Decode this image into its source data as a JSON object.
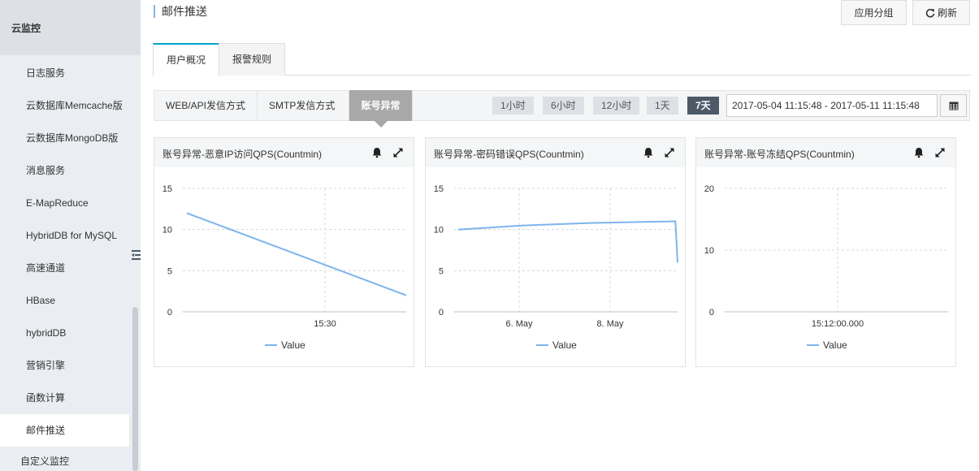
{
  "sidebar": {
    "header": "云监控",
    "items": [
      {
        "label": "日志服务"
      },
      {
        "label": "云数据库Memcache版"
      },
      {
        "label": "云数据库MongoDB版"
      },
      {
        "label": "消息服务"
      },
      {
        "label": "E-MapReduce"
      },
      {
        "label": "HybridDB for MySQL"
      },
      {
        "label": "高速通道"
      },
      {
        "label": "HBase"
      },
      {
        "label": "hybridDB"
      },
      {
        "label": "营销引擎"
      },
      {
        "label": "函数计算"
      },
      {
        "label": "邮件推送",
        "active": true
      }
    ],
    "footer_item": "自定义监控"
  },
  "header": {
    "title": "邮件推送",
    "group_button": "应用分组",
    "refresh_button": "刷新"
  },
  "tabs": [
    {
      "label": "用户概况",
      "active": true
    },
    {
      "label": "报警规则",
      "active": false
    }
  ],
  "modes": [
    {
      "label": "WEB/API发信方式"
    },
    {
      "label": "SMTP发信方式"
    },
    {
      "label": "账号异常",
      "active": true
    }
  ],
  "ranges": [
    {
      "label": "1小时"
    },
    {
      "label": "6小时"
    },
    {
      "label": "12小时"
    },
    {
      "label": "1天"
    },
    {
      "label": "7天",
      "active": true
    }
  ],
  "date_range": "2017-05-04 11:15:48 - 2017-05-11 11:15:48",
  "colors": {
    "accent": "#00a2ca",
    "series": "#7cb5ec",
    "active_range": "#4c5a68"
  },
  "chart_data": [
    {
      "type": "line",
      "title": "账号异常-恶意IP访问QPS(Countmin)",
      "ylim": [
        0,
        15
      ],
      "yticks": [
        0,
        5,
        10,
        15
      ],
      "xticks": [
        "15:30"
      ],
      "series": [
        {
          "name": "Value",
          "points": [
            [
              0,
              12
            ],
            [
              1,
              2
            ]
          ]
        }
      ]
    },
    {
      "type": "line",
      "title": "账号异常-密码错误QPS(Countmin)",
      "ylim": [
        0,
        15
      ],
      "yticks": [
        0,
        5,
        10,
        15
      ],
      "xticks": [
        "6. May",
        "8. May"
      ],
      "series": [
        {
          "name": "Value",
          "points": [
            [
              0,
              10
            ],
            [
              0.3,
              10.5
            ],
            [
              0.6,
              10.8
            ],
            [
              0.99,
              11
            ],
            [
              1,
              6
            ]
          ]
        }
      ]
    },
    {
      "type": "line",
      "title": "账号异常-账号冻结QPS(Countmin)",
      "ylim": [
        0,
        20
      ],
      "yticks": [
        0,
        10,
        20
      ],
      "xticks": [
        "15:12:00.000"
      ],
      "series": [
        {
          "name": "Value",
          "points": []
        }
      ]
    }
  ]
}
